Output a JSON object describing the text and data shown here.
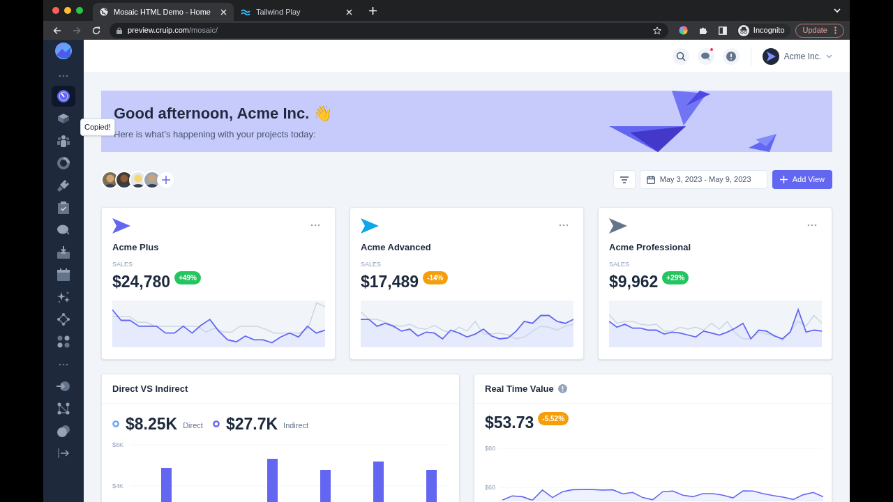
{
  "browser": {
    "tabs": [
      {
        "title": "Mosaic HTML Demo - Home",
        "selected": true
      },
      {
        "title": "Tailwind Play",
        "selected": false
      }
    ],
    "nav_buttons": [
      {
        "kind": "back",
        "disabled": false
      },
      {
        "kind": "forward",
        "disabled": true
      },
      {
        "kind": "reload",
        "disabled": false
      }
    ],
    "url": {
      "host": "preview.cruip.com",
      "path": "/mosaic/"
    },
    "profile": "Incognito",
    "update_button": "Update"
  },
  "sidebar": {
    "top_items": [
      {
        "selected": true
      },
      {
        "selected": false
      },
      {
        "selected": false
      },
      {
        "selected": false
      },
      {
        "selected": false
      },
      {
        "selected": false
      },
      {
        "selected": false
      },
      {
        "selected": false
      },
      {
        "selected": false
      },
      {
        "selected": false
      },
      {
        "selected": false
      },
      {
        "selected": false
      }
    ],
    "bottom_items": [
      {
        "selected": false
      },
      {
        "selected": false
      },
      {
        "selected": false
      }
    ],
    "tooltip": "Copied!"
  },
  "header": {
    "messages_unread": true,
    "account": "Acme Inc."
  },
  "banner": {
    "title": "Good afternoon, Acme Inc. 👋",
    "subtitle": "Here is what’s happening with your projects today:"
  },
  "date_range": "May 3, 2023 - May 9, 2023",
  "add_view_button": "Add View",
  "products": [
    {
      "name": "Acme Plus",
      "label": "SALES",
      "value": "$24,780",
      "badge": {
        "text": "+49%",
        "color": "#22c55e"
      },
      "color": "#6366f1"
    },
    {
      "name": "Acme Advanced",
      "label": "SALES",
      "value": "$17,489",
      "badge": {
        "text": "-14%",
        "color": "#f59e0b"
      },
      "color": "#0ea5e9"
    },
    {
      "name": "Acme Professional",
      "label": "SALES",
      "value": "$9,962",
      "badge": {
        "text": "+29%",
        "color": "#22c55e"
      },
      "color": "#64748b"
    }
  ],
  "direct_vs_indirect": {
    "title": "Direct VS Indirect",
    "legend": [
      {
        "value": "$8.25K",
        "label": "Direct",
        "color": "#60a5fa"
      },
      {
        "value": "$27.7K",
        "label": "Indirect",
        "color": "#6366f1"
      }
    ],
    "chart_data": {
      "type": "bar",
      "ylim": [
        0,
        6000
      ],
      "yticks": [
        {
          "value": 4000,
          "label": "$4K"
        },
        {
          "value": 6000,
          "label": "$6K"
        }
      ],
      "series": [
        {
          "color": "#6366f1",
          "values": [
            4880,
            null,
            5320,
            4780,
            5190,
            4780
          ]
        }
      ]
    }
  },
  "real_time": {
    "title": "Real Time Value",
    "value": "$53.73",
    "badge": {
      "text": "-5.52%",
      "color": "#f59e0b"
    },
    "chart_data": {
      "type": "area",
      "ylim": [
        53,
        80
      ],
      "yticks": [
        {
          "value": 60,
          "label": "$60"
        },
        {
          "value": 80,
          "label": "$80"
        }
      ],
      "series": [
        {
          "color": "#6366f1",
          "values": [
            53.5,
            55.6,
            55.2,
            53.4,
            58.6,
            54.8,
            57.8,
            58.8,
            58.9,
            58.9,
            58.6,
            58.8,
            56.7,
            57.4,
            54.8,
            53.6,
            57.8,
            58.1,
            56.0,
            55.2,
            56.8,
            56.8,
            56.0,
            54.6,
            58.2,
            58.1,
            56.8,
            55.8,
            55.0,
            53.8,
            56.2,
            57.4,
            55.2
          ]
        }
      ]
    }
  }
}
